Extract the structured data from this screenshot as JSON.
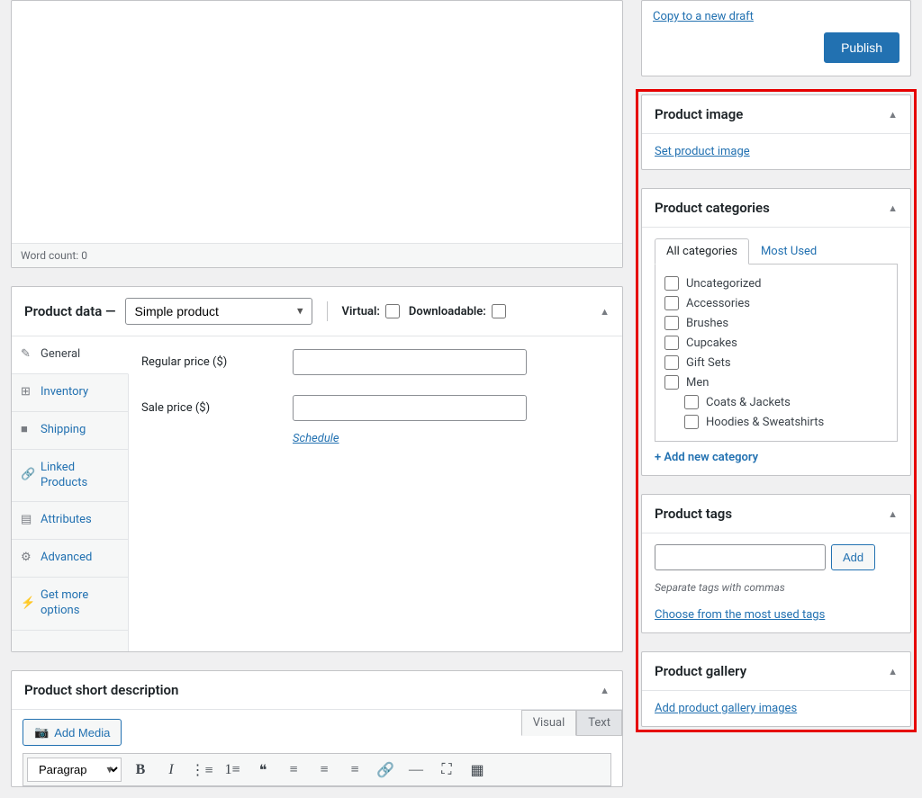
{
  "publish": {
    "copy_draft": "Copy to a new draft",
    "publish_btn": "Publish"
  },
  "editor": {
    "word_count_label": "Word count:",
    "word_count_value": "0"
  },
  "product_data": {
    "title": "Product data —",
    "type_selected": "Simple product",
    "virtual_label": "Virtual:",
    "downloadable_label": "Downloadable:",
    "tabs": [
      {
        "icon": "✎",
        "label": "General"
      },
      {
        "icon": "⊞",
        "label": "Inventory"
      },
      {
        "icon": "■",
        "label": "Shipping"
      },
      {
        "icon": "🔗",
        "label": "Linked Products"
      },
      {
        "icon": "▤",
        "label": "Attributes"
      },
      {
        "icon": "⚙",
        "label": "Advanced"
      },
      {
        "icon": "⚡",
        "label": "Get more options"
      }
    ],
    "regular_price_label": "Regular price ($)",
    "sale_price_label": "Sale price ($)",
    "schedule": "Schedule"
  },
  "product_image": {
    "title": "Product image",
    "link": "Set product image"
  },
  "product_categories": {
    "title": "Product categories",
    "tab_all": "All categories",
    "tab_used": "Most Used",
    "items": [
      {
        "label": "Uncategorized",
        "child": false
      },
      {
        "label": "Accessories",
        "child": false
      },
      {
        "label": "Brushes",
        "child": false
      },
      {
        "label": "Cupcakes",
        "child": false
      },
      {
        "label": "Gift Sets",
        "child": false
      },
      {
        "label": "Men",
        "child": false
      },
      {
        "label": "Coats & Jackets",
        "child": true
      },
      {
        "label": "Hoodies & Sweatshirts",
        "child": true
      }
    ],
    "add_new": "+ Add new category"
  },
  "product_tags": {
    "title": "Product tags",
    "add_btn": "Add",
    "hint": "Separate tags with commas",
    "choose": "Choose from the most used tags"
  },
  "product_gallery": {
    "title": "Product gallery",
    "link": "Add product gallery images"
  },
  "short_desc": {
    "title": "Product short description",
    "add_media": "Add Media",
    "visual": "Visual",
    "text": "Text",
    "format": "Paragraph"
  }
}
